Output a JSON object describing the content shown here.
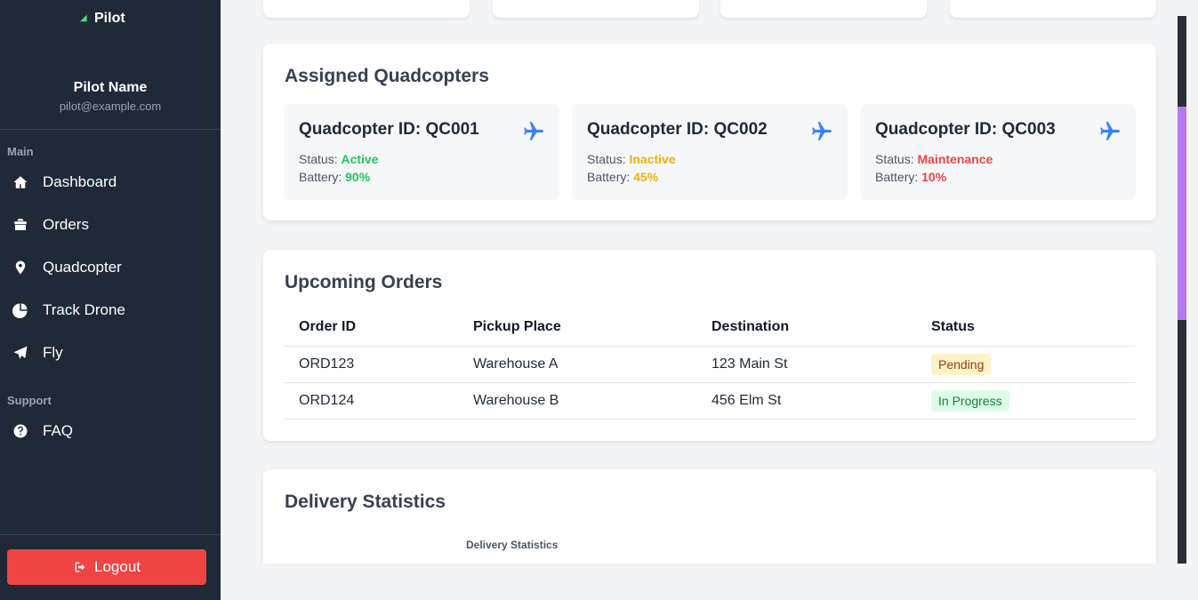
{
  "app": {
    "brand": "Pilot"
  },
  "profile": {
    "name": "Pilot Name",
    "email": "pilot@example.com"
  },
  "sidebar": {
    "main_label": "Main",
    "items": [
      {
        "label": "Dashboard",
        "icon": "home-icon"
      },
      {
        "label": "Orders",
        "icon": "box-icon"
      },
      {
        "label": "Quadcopter",
        "icon": "map-pin-icon"
      },
      {
        "label": "Track Drone",
        "icon": "pie-chart-icon"
      },
      {
        "label": "Fly",
        "icon": "paper-plane-icon"
      }
    ],
    "support_label": "Support",
    "support_items": [
      {
        "label": "FAQ",
        "icon": "question-circle-icon"
      }
    ],
    "logout_label": "Logout"
  },
  "assigned": {
    "title": "Assigned Quadcopters",
    "quadcopters": [
      {
        "id_text": "Quadcopter ID: QC001",
        "status_label": "Status:",
        "status": "Active",
        "battery_label": "Battery:",
        "battery": "90%",
        "color": "#22c55e"
      },
      {
        "id_text": "Quadcopter ID: QC002",
        "status_label": "Status:",
        "status": "Inactive",
        "battery_label": "Battery:",
        "battery": "45%",
        "color": "#eab308"
      },
      {
        "id_text": "Quadcopter ID: QC003",
        "status_label": "Status:",
        "status": "Maintenance",
        "battery_label": "Battery:",
        "battery": "10%",
        "color": "#ef4444"
      }
    ]
  },
  "orders": {
    "title": "Upcoming Orders",
    "columns": [
      "Order ID",
      "Pickup Place",
      "Destination",
      "Status"
    ],
    "rows": [
      {
        "id": "ORD123",
        "pickup": "Warehouse A",
        "destination": "123 Main St",
        "status": "Pending"
      },
      {
        "id": "ORD124",
        "pickup": "Warehouse B",
        "destination": "456 Elm St",
        "status": "In Progress"
      }
    ]
  },
  "stats": {
    "title": "Delivery Statistics",
    "chart_caption": "Delivery Statistics"
  }
}
